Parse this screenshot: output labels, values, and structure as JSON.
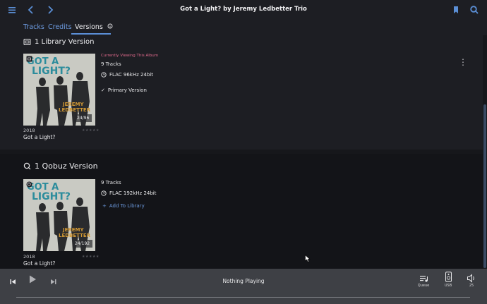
{
  "topbar": {
    "title": "Got a Light? by Jeremy Ledbetter Trio",
    "icons": [
      "menu-icon",
      "back-icon",
      "forward-icon",
      "bookmark-icon",
      "search-icon"
    ]
  },
  "tabs": [
    {
      "label": "Tracks"
    },
    {
      "label": "Credits"
    },
    {
      "label": "Versions",
      "active": true
    }
  ],
  "library_section": {
    "heading": "1 Library Version",
    "album": {
      "cover_line1": "GOT A",
      "cover_line2": "LIGHT?",
      "cover_artist1": "JEREMY",
      "cover_artist2": "LEDBETTER",
      "cover_badge": "24/96",
      "year": "2018",
      "name": "Got a Light?",
      "viewing_label": "Currently Viewing This Album",
      "tracks": "9 Tracks",
      "format": "FLAC 96kHz 24bit",
      "primary": "Primary Version"
    }
  },
  "qobuz_section": {
    "heading": "1 Qobuz Version",
    "album": {
      "cover_line1": "GOT A",
      "cover_line2": "LIGHT?",
      "cover_artist1": "JEREMY",
      "cover_artist2": "LEDBETTER",
      "cover_badge": "24/192",
      "year": "2018",
      "name": "Got a Light?",
      "tracks": "9 Tracks",
      "format": "FLAC 192kHz 24bit",
      "add_label": "Add To Library"
    }
  },
  "player": {
    "now_playing": "Nothing Playing",
    "queue_label": "Queue",
    "output_label": "USB",
    "volume": "25"
  },
  "colors": {
    "accent": "#5b8fd6",
    "viewing": "#e06a8c",
    "background": "#16171b",
    "player": "#3e4045"
  }
}
